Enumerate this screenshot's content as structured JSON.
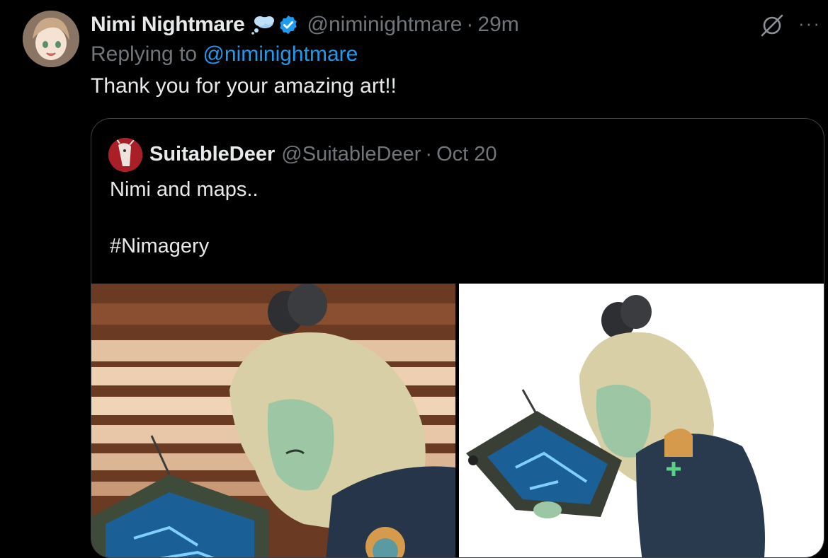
{
  "tweet": {
    "author_name": "Nimi Nightmare",
    "author_handle": "@niminightmare",
    "separator": "·",
    "time": "29m",
    "replying_prefix": "Replying to",
    "replying_handle": "@niminightmare",
    "text": "Thank you for your amazing art!!",
    "badges": [
      "thought-bubble-icon",
      "verified-icon"
    ],
    "actions": [
      "grok-icon",
      "more-icon"
    ],
    "more_glyph": "···"
  },
  "quote": {
    "author_name": "SuitableDeer",
    "author_handle": "@SuitableDeer",
    "separator": "·",
    "date": "Oct 20",
    "line1": "Nimi and maps..",
    "line2": "#Nimagery",
    "media": [
      "illustration-striped-background",
      "illustration-white-background"
    ]
  },
  "colors": {
    "background": "#000000",
    "text": "#e7e9ea",
    "muted": "#71767b",
    "link": "#1d9bf0",
    "border": "#3e4144"
  }
}
